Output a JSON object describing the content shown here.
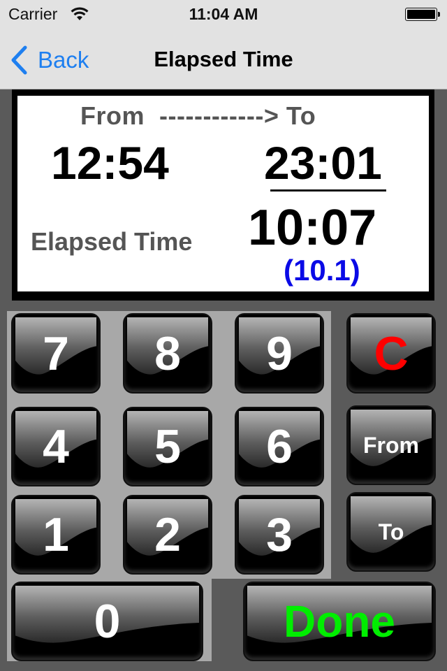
{
  "status_bar": {
    "carrier": "Carrier",
    "time": "11:04 AM",
    "wifi_icon": "wifi-icon",
    "battery_icon": "battery-full-icon"
  },
  "nav": {
    "back_label": "Back",
    "back_icon": "chevron-left-icon",
    "title": "Elapsed Time"
  },
  "display": {
    "header": "From  ------------> To",
    "from_time": "12:54",
    "to_time": "23:01",
    "elapsed_label": "Elapsed Time",
    "elapsed_time": "10:07",
    "elapsed_decimal": "(10.1)"
  },
  "keypad": {
    "keys": [
      "7",
      "8",
      "9",
      "4",
      "5",
      "6",
      "1",
      "2",
      "3",
      "0"
    ],
    "clear_label": "C",
    "from_label": "From",
    "to_label": "To",
    "done_label": "Done"
  },
  "colors": {
    "accent_blue": "#1e7ff0",
    "decimal_blue": "#0a0ae6",
    "clear_red": "#ff0000",
    "done_green": "#00ee00"
  }
}
